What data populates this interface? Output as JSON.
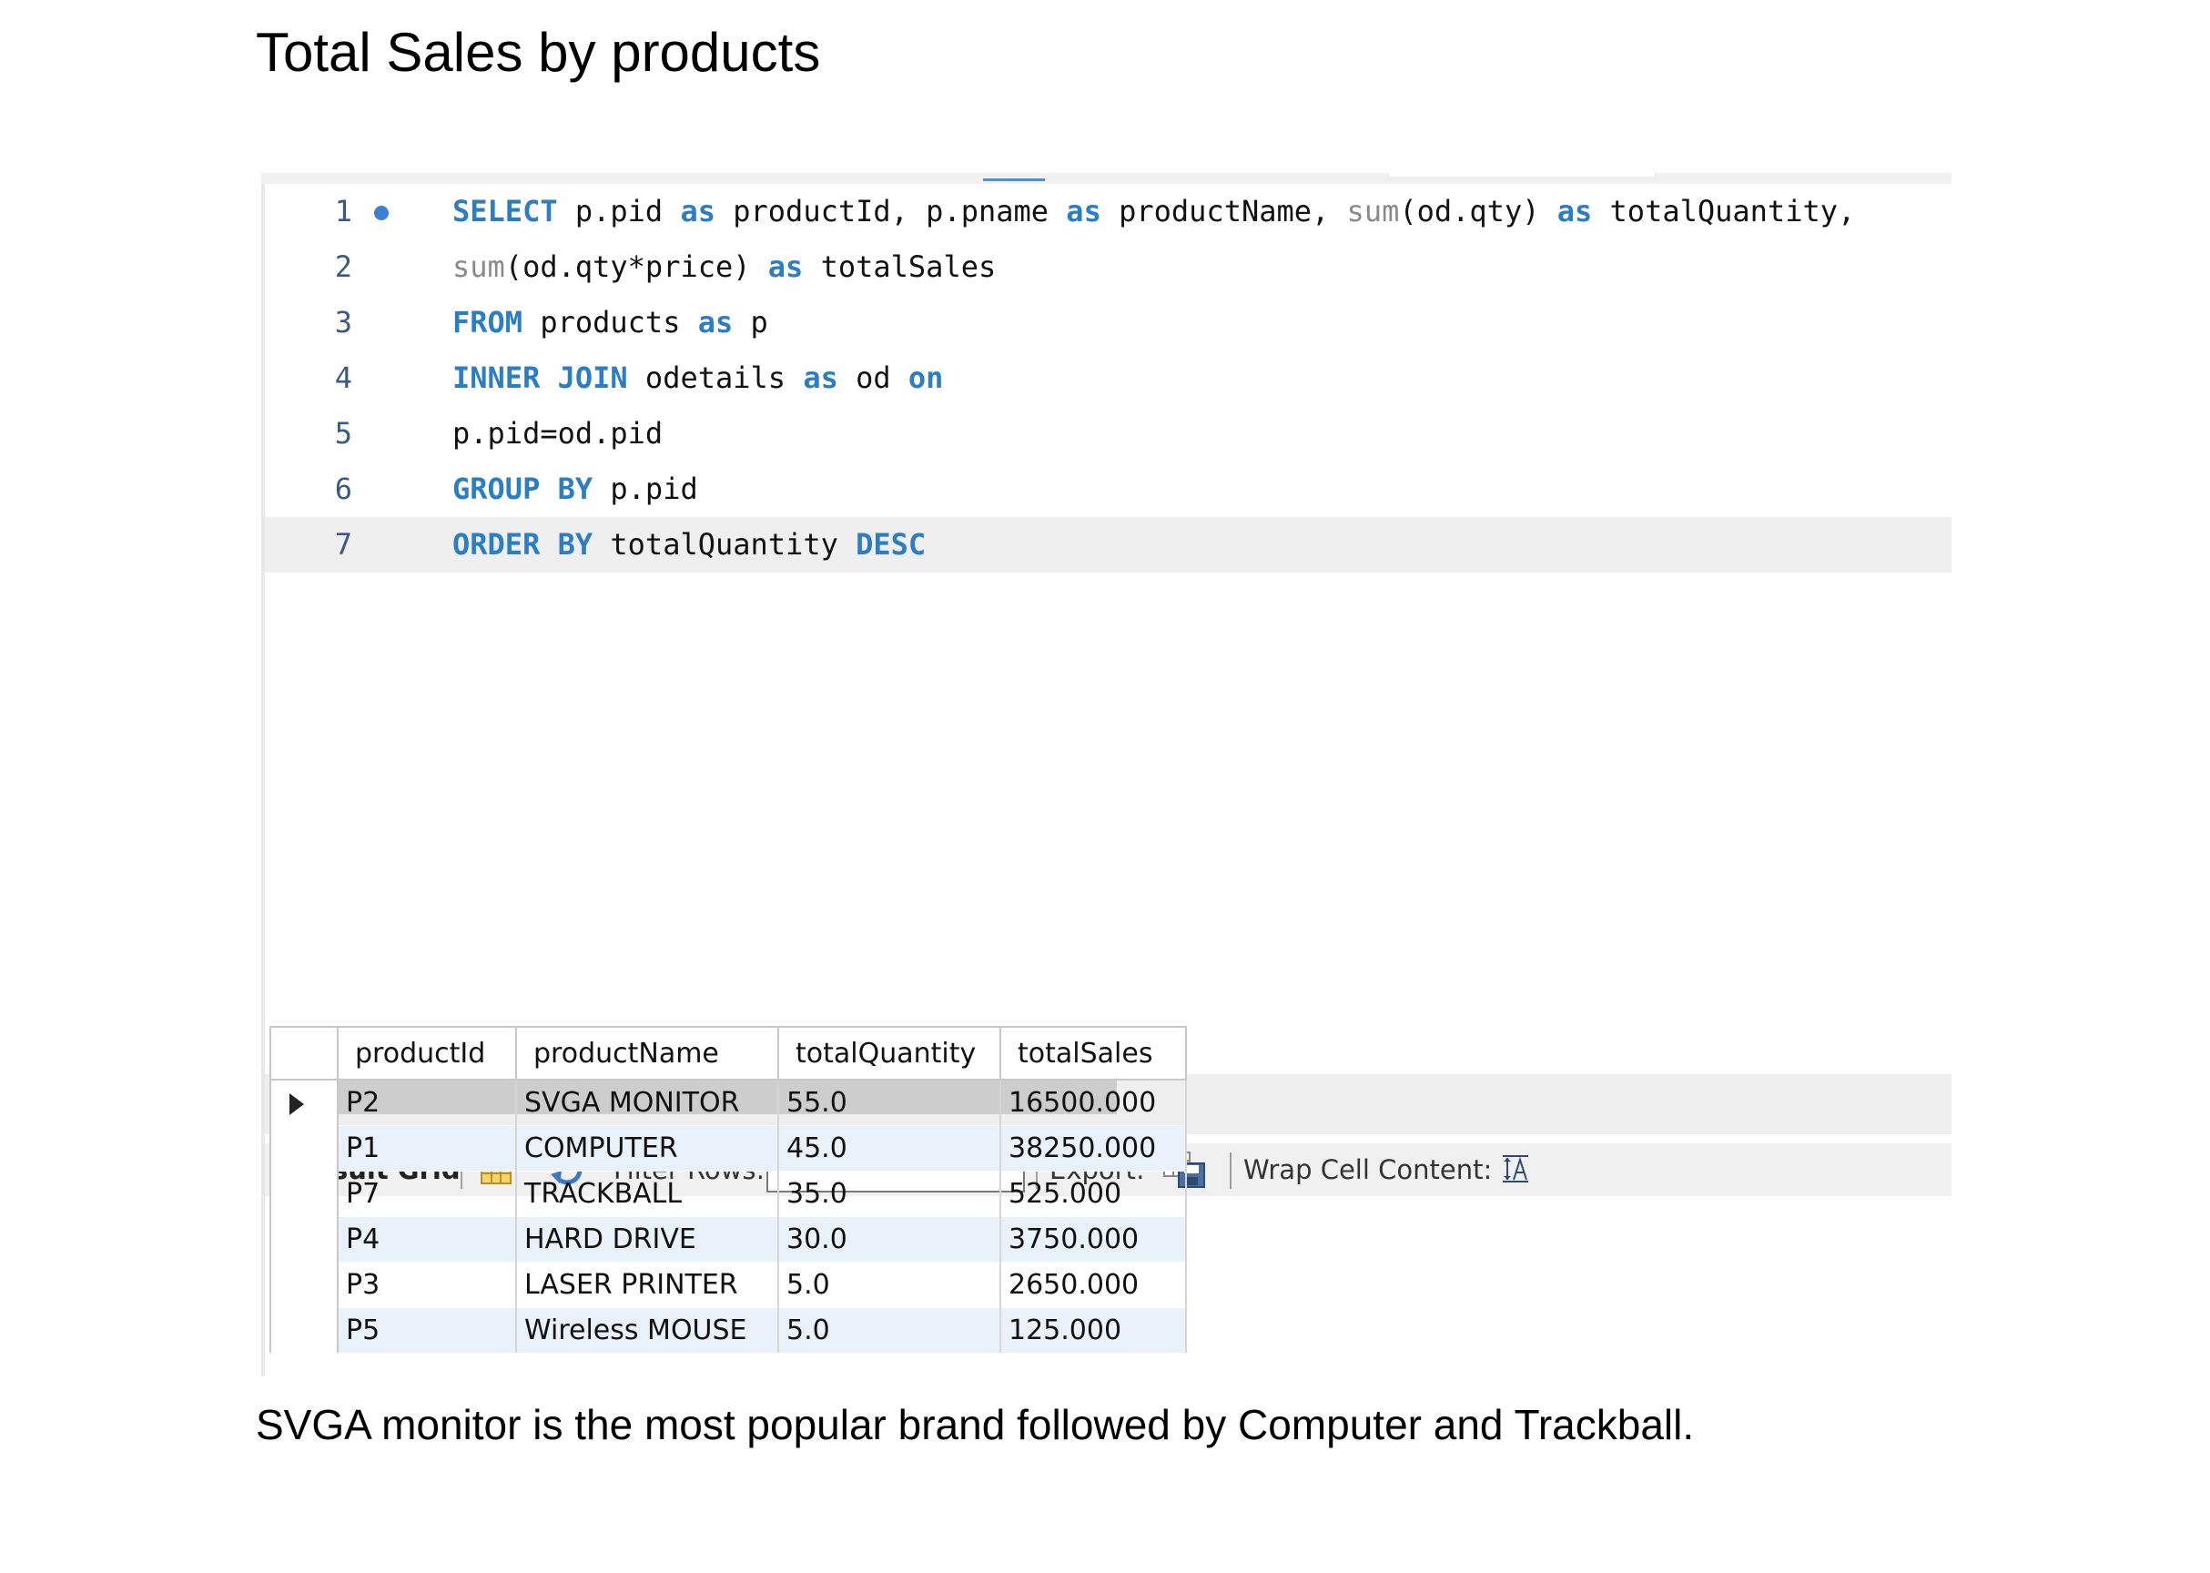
{
  "page": {
    "title": "Total Sales by products",
    "summary": "SVGA monitor is the most popular brand followed by Computer and Trackball."
  },
  "editor": {
    "lines": [
      {
        "num": "1",
        "tokens": [
          {
            "t": "SELECT",
            "k": "kw"
          },
          {
            "t": " p.pid ",
            "k": ""
          },
          {
            "t": "as",
            "k": "kw"
          },
          {
            "t": " productId, p.pname ",
            "k": ""
          },
          {
            "t": "as",
            "k": "kw"
          },
          {
            "t": " productName, ",
            "k": ""
          },
          {
            "t": "sum",
            "k": "fn"
          },
          {
            "t": "(od.qty) ",
            "k": ""
          },
          {
            "t": "as",
            "k": "kw"
          },
          {
            "t": " totalQuantity,",
            "k": ""
          }
        ]
      },
      {
        "num": "2",
        "tokens": [
          {
            "t": "sum",
            "k": "fn"
          },
          {
            "t": "(od.qty*price) ",
            "k": ""
          },
          {
            "t": "as",
            "k": "kw"
          },
          {
            "t": " totalSales",
            "k": ""
          }
        ]
      },
      {
        "num": "3",
        "tokens": [
          {
            "t": "FROM",
            "k": "kw"
          },
          {
            "t": " products ",
            "k": ""
          },
          {
            "t": "as",
            "k": "kw"
          },
          {
            "t": " p",
            "k": ""
          }
        ]
      },
      {
        "num": "4",
        "tokens": [
          {
            "t": "INNER JOIN",
            "k": "kw"
          },
          {
            "t": " odetails ",
            "k": ""
          },
          {
            "t": "as",
            "k": "kw"
          },
          {
            "t": " od ",
            "k": ""
          },
          {
            "t": "on",
            "k": "kw"
          }
        ]
      },
      {
        "num": "5",
        "tokens": [
          {
            "t": "p.pid=od.pid",
            "k": ""
          }
        ]
      },
      {
        "num": "6",
        "tokens": [
          {
            "t": "GROUP BY",
            "k": "kw"
          },
          {
            "t": " p.pid",
            "k": ""
          }
        ]
      },
      {
        "num": "7",
        "tokens": [
          {
            "t": "ORDER BY",
            "k": "kw"
          },
          {
            "t": " totalQuantity ",
            "k": ""
          },
          {
            "t": "DESC",
            "k": "kw"
          }
        ]
      }
    ],
    "scroll_left_glyph": "<"
  },
  "toolbar": {
    "result_grid_label": "Result Grid",
    "filter_rows_label": "Filter Rows:",
    "filter_value": "",
    "export_label": "Export:",
    "wrap_label": "Wrap Cell Content:"
  },
  "grid": {
    "columns": [
      "productId",
      "productName",
      "totalQuantity",
      "totalSales"
    ],
    "rows": [
      [
        "P2",
        "SVGA MONITOR",
        "55.0",
        "16500.000"
      ],
      [
        "P1",
        "COMPUTER",
        "45.0",
        "38250.000"
      ],
      [
        "P7",
        "TRACKBALL",
        "35.0",
        "525.000"
      ],
      [
        "P4",
        "HARD DRIVE",
        "30.0",
        "3750.000"
      ],
      [
        "P3",
        "LASER PRINTER",
        "5.0",
        "2650.000"
      ],
      [
        "P5",
        "Wireless MOUSE",
        "5.0",
        "125.000"
      ]
    ],
    "selected_row": 0
  },
  "colors": {
    "keyword": "#2b7dc4",
    "function": "#8a8a8a",
    "line_number": "#3a5a82",
    "alt_row": "#e9f1fb",
    "current_line": "#efefef"
  },
  "icons": [
    "breakpoint-dot-icon",
    "grid-layout-icon",
    "refresh-icon",
    "export-save-icon",
    "wrap-text-icon",
    "row-pointer-icon",
    "scroll-left-icon"
  ]
}
